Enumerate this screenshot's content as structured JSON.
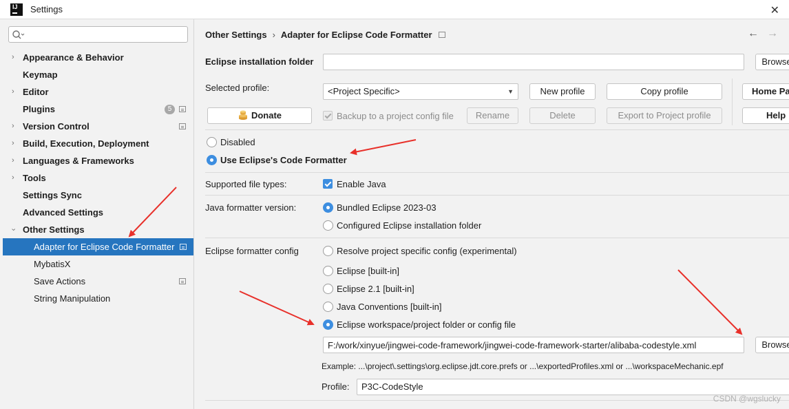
{
  "window": {
    "title": "Settings",
    "app_icon_text": "IJ",
    "close_glyph": "✕"
  },
  "search": {
    "placeholder": ""
  },
  "sidebar": {
    "items": [
      {
        "label": "Appearance & Behavior",
        "expandable": true
      },
      {
        "label": "Keymap"
      },
      {
        "label": "Editor",
        "expandable": true
      },
      {
        "label": "Plugins",
        "badge": "5",
        "project_icon": true
      },
      {
        "label": "Version Control",
        "expandable": true,
        "project_icon": true
      },
      {
        "label": "Build, Execution, Deployment",
        "expandable": true
      },
      {
        "label": "Languages & Frameworks",
        "expandable": true
      },
      {
        "label": "Tools",
        "expandable": true
      },
      {
        "label": "Settings Sync"
      },
      {
        "label": "Advanced Settings"
      },
      {
        "label": "Other Settings",
        "expanded": true
      },
      {
        "label": "Adapter for Eclipse Code Formatter",
        "selected": true,
        "project_icon": true
      },
      {
        "label": "MybatisX"
      },
      {
        "label": "Save Actions",
        "project_icon": true
      },
      {
        "label": "String Manipulation"
      }
    ]
  },
  "breadcrumb": {
    "parent": "Other Settings",
    "separator": "›",
    "current": "Adapter for Eclipse Code Formatter"
  },
  "nav": {
    "back": "←",
    "forward": "→"
  },
  "install": {
    "label": "Eclipse installation folder",
    "value": "",
    "browse": "Browse"
  },
  "profile": {
    "label": "Selected profile:",
    "selected": "<Project Specific>",
    "new_btn": "New profile",
    "copy_btn": "Copy profile",
    "home_btn": "Home Page",
    "donate_btn": "Donate",
    "backup_label": "Backup to a project config file",
    "rename_btn": "Rename",
    "delete_btn": "Delete",
    "export_btn": "Export to Project profile",
    "help_btn": "Help"
  },
  "mode": {
    "disabled": "Disabled",
    "use_eclipse": "Use Eclipse's Code Formatter"
  },
  "file_types": {
    "label": "Supported file types:",
    "enable_java": "Enable Java"
  },
  "java_version": {
    "label": "Java formatter version:",
    "bundled": "Bundled Eclipse 2023-03",
    "configured": "Configured Eclipse installation folder"
  },
  "formatter_config": {
    "label": "Eclipse formatter config",
    "options": [
      "Resolve project specific config (experimental)",
      "Eclipse [built-in]",
      "Eclipse 2.1 [built-in]",
      "Java Conventions [built-in]",
      "Eclipse workspace/project folder or config file"
    ],
    "path": "F:/work/xinyue/jingwei-code-framework/jingwei-code-framework-starter/alibaba-codestyle.xml",
    "browse": "Browse",
    "example": "Example: ...\\project\\.settings\\org.eclipse.jdt.core.prefs or ...\\exportedProfiles.xml or ...\\workspaceMechanic.epf",
    "profile_label": "Profile:",
    "profile_value": "P3C-CodeStyle"
  },
  "watermark": "CSDN @wgslucky",
  "colors": {
    "selection": "#2675bf",
    "radio_on": "#3d8ee0",
    "annotation_arrow": "#e8302a"
  },
  "icons": {
    "search": "search-icon",
    "donate": "coins-icon",
    "project": "project-scope-icon",
    "dropdown": "chevron-down-icon"
  }
}
